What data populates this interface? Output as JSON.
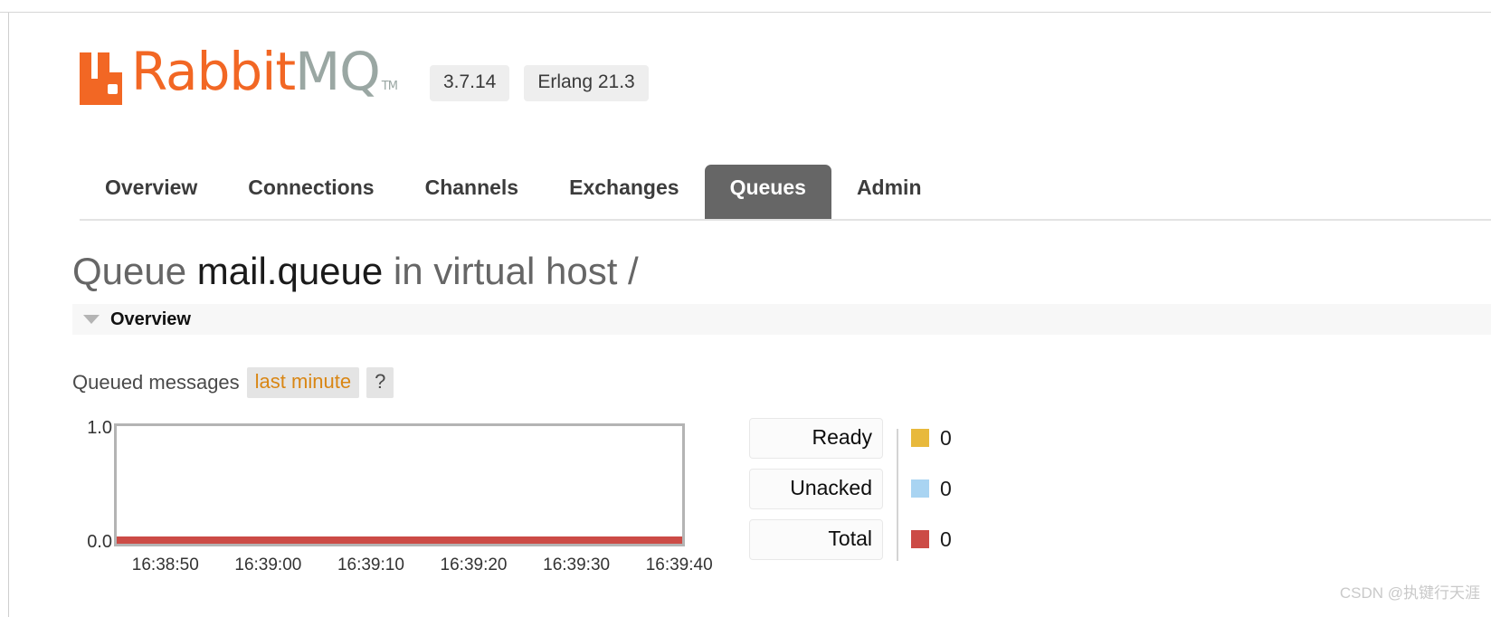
{
  "browser": {
    "toolbar_glyphs": "· · · · · · · · · · · · · · ·"
  },
  "header": {
    "logo_text_1": "Rabbit",
    "logo_text_2": "MQ",
    "logo_tm": "TM",
    "version_badge": "3.7.14",
    "erlang_badge": "Erlang 21.3"
  },
  "nav": {
    "items": [
      {
        "label": "Overview",
        "active": false
      },
      {
        "label": "Connections",
        "active": false
      },
      {
        "label": "Channels",
        "active": false
      },
      {
        "label": "Exchanges",
        "active": false
      },
      {
        "label": "Queues",
        "active": true
      },
      {
        "label": "Admin",
        "active": false
      }
    ]
  },
  "page": {
    "title_prefix": "Queue",
    "title_queue_name": "mail.queue",
    "title_middle": "in virtual host",
    "title_vhost": "/",
    "section_overview": "Overview"
  },
  "queued_messages": {
    "label": "Queued messages",
    "range_link": "last minute",
    "help": "?"
  },
  "chart_data": {
    "type": "line",
    "title": "Queued messages",
    "xlabel": "",
    "ylabel": "",
    "x": [
      "16:38:50",
      "16:39:00",
      "16:39:10",
      "16:39:20",
      "16:39:30",
      "16:39:40"
    ],
    "ylim": [
      0,
      1
    ],
    "ytick_labels": [
      "0.0",
      "1.0"
    ],
    "grid": false,
    "legend_position": "right",
    "series": [
      {
        "name": "Ready",
        "color": "#e8b93c",
        "value": "0",
        "values": [
          0,
          0,
          0,
          0,
          0,
          0
        ]
      },
      {
        "name": "Unacked",
        "color": "#a9d4f2",
        "value": "0",
        "values": [
          0,
          0,
          0,
          0,
          0,
          0
        ]
      },
      {
        "name": "Total",
        "color": "#cc4b46",
        "value": "0",
        "values": [
          0,
          0,
          0,
          0,
          0,
          0
        ]
      }
    ]
  },
  "watermark": {
    "text": "CSDN @执键行天涯"
  }
}
